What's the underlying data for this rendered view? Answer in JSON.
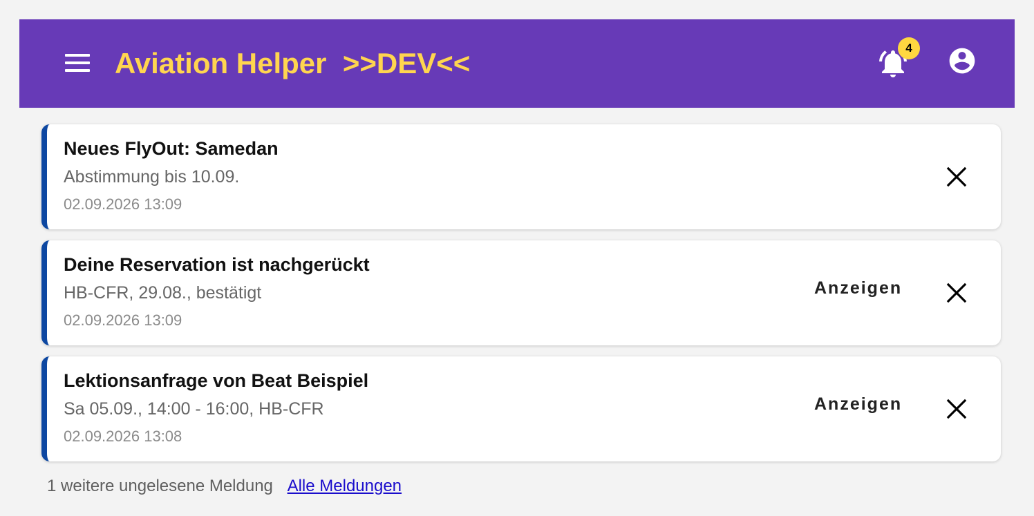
{
  "header": {
    "title": "Aviation Helper  >>DEV<<",
    "notification_count": "4",
    "icons": {
      "menu": "menu-icon",
      "bell": "bell-ring-icon",
      "account": "account-circle-icon"
    },
    "colors": {
      "toolbar": "#673ab7",
      "title": "#ffd54f",
      "badge": "#ffd740"
    }
  },
  "notifications": [
    {
      "title": "Neues FlyOut: Samedan",
      "subtitle": "Abstimmung bis 10.09.",
      "timestamp": "02.09.2026 13:09",
      "action_label": ""
    },
    {
      "title": "Deine Reservation ist nachgerückt",
      "subtitle": "HB-CFR, 29.08., bestätigt",
      "timestamp": "02.09.2026 13:09",
      "action_label": "Anzeigen"
    },
    {
      "title": "Lektionsanfrage von Beat Beispiel",
      "subtitle": "Sa 05.09., 14:00 - 16:00, HB-CFR",
      "timestamp": "02.09.2026 13:08",
      "action_label": "Anzeigen"
    }
  ],
  "footer": {
    "unread_text": "1 weitere ungelesene Meldung",
    "all_link": "Alle Meldungen"
  },
  "accent_color": "#0d47a1"
}
